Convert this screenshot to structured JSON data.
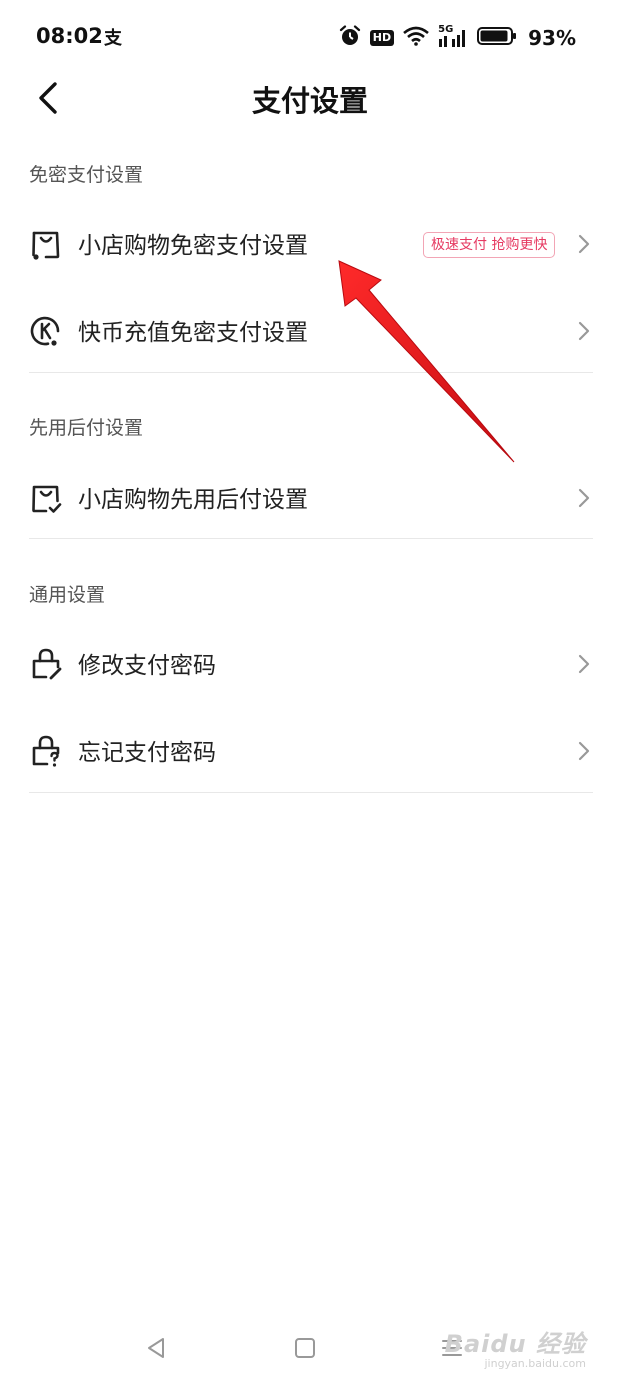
{
  "status_bar": {
    "time": "08:02",
    "alipay_glyph": "支",
    "hd_label": "HD",
    "network": "5G",
    "battery_percent": "93%",
    "battery_level": 0.93,
    "icons": [
      "alarm-icon",
      "hd-icon",
      "wifi-icon",
      "signal-5g-icon",
      "battery-icon"
    ]
  },
  "header": {
    "title": "支付设置",
    "back_icon": "chevron-left-icon"
  },
  "sections": [
    {
      "title": "免密支付设置",
      "items": [
        {
          "label": "小店购物免密支付设置",
          "icon": "shopping-bag-icon",
          "badge": "极速支付 抢购更快"
        },
        {
          "label": "快币充值免密支付设置",
          "icon": "coin-k-icon"
        }
      ]
    },
    {
      "title": "先用后付设置",
      "items": [
        {
          "label": "小店购物先用后付设置",
          "icon": "shopping-bag-check-icon"
        }
      ]
    },
    {
      "title": "通用设置",
      "items": [
        {
          "label": "修改支付密码",
          "icon": "lock-edit-icon"
        },
        {
          "label": "忘记支付密码",
          "icon": "lock-question-icon"
        }
      ]
    }
  ],
  "colors": {
    "badge_text": "#e63a62",
    "badge_border": "#f2a5b5",
    "annotation_arrow": "#e8141c",
    "divider": "#e8e8e8"
  },
  "nav_bar": {
    "icons": [
      "back-triangle-icon",
      "home-square-icon",
      "menu-lines-icon"
    ]
  },
  "watermark": {
    "brand": "Baidu 经验",
    "url": "jingyan.baidu.com"
  }
}
